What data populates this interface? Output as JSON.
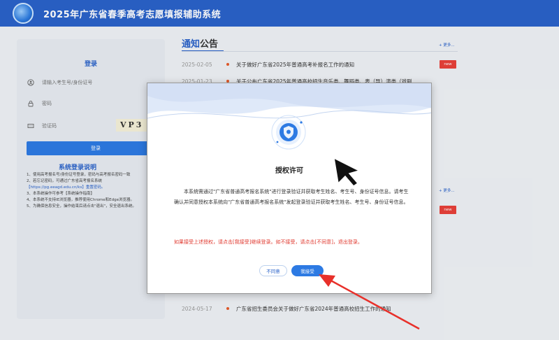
{
  "header": {
    "title": "2025年广东省春季高考志愿填报辅助系统"
  },
  "login": {
    "title": "登录",
    "username_placeholder": "请输入考生号/身份证号",
    "password_placeholder": "密码",
    "captcha_placeholder": "验证码",
    "captcha_text": "VP3",
    "button_label": "登录"
  },
  "system_notes": {
    "title": "系统登录说明",
    "lines": [
      "1、使用高考报名号/身份证号登录，密码与高考报名密码一致",
      "2、若忘记密码，可通过广东省高考报名系统",
      "【https://pg.eeagd.edu.cn/ks】重置密码。",
      "3、本系统操作可参考【系统操作指南】",
      "4、本系统不支持IE浏览器，推荐使用Chrome和Edge浏览器。",
      "5、为确保信息安全，操作结束后请点击\"退出\"，安全退出系统。"
    ]
  },
  "notices": {
    "title_highlight": "通知",
    "title_rest": "公告",
    "more_label": "+ 更多...",
    "new_label": "new",
    "items": [
      {
        "date": "2025-02-05",
        "text": "关于做好广东省2025年普通高考补报名工作的通知"
      },
      {
        "date": "2025-01-23",
        "text": "关于公布广东省2025年普通高校招生音乐类、舞蹈类、表（导）演类（戏剧"
      },
      {
        "date": "2024-05-17",
        "text": "广东省招生委员会关于做好广东省2024年普通高校招生工作的通知"
      }
    ]
  },
  "dialog": {
    "title": "授权许可",
    "body": "本系统需通过\"广东省普通高考报名系统\"进行登录验证并获取考生姓名、考生号、身份证号信息。请考生确认并同意授权本系统向\"广东省普通高考报名系统\"发起登录验证并获取考生姓名、考生号、身份证号信息。",
    "warning": "如果接受上述授权，请点击[我接受]继续登录。如不接受，请点击[不同意]，退出登录。",
    "decline_label": "不同意",
    "accept_label": "我接受"
  },
  "colors": {
    "header_bg": "#2a62c9",
    "primary": "#2d7ae3",
    "warning": "#e0392f",
    "new_badge": "#e8413a",
    "annotation_arrow": "#e8302a"
  },
  "icons": {
    "header_logo": "logo-icon",
    "username": "user-icon",
    "password": "lock-icon",
    "captcha": "captcha-icon",
    "dialog_badge": "shield-icon",
    "cursor": "cursor-icon",
    "annotation": "arrow-icon"
  }
}
